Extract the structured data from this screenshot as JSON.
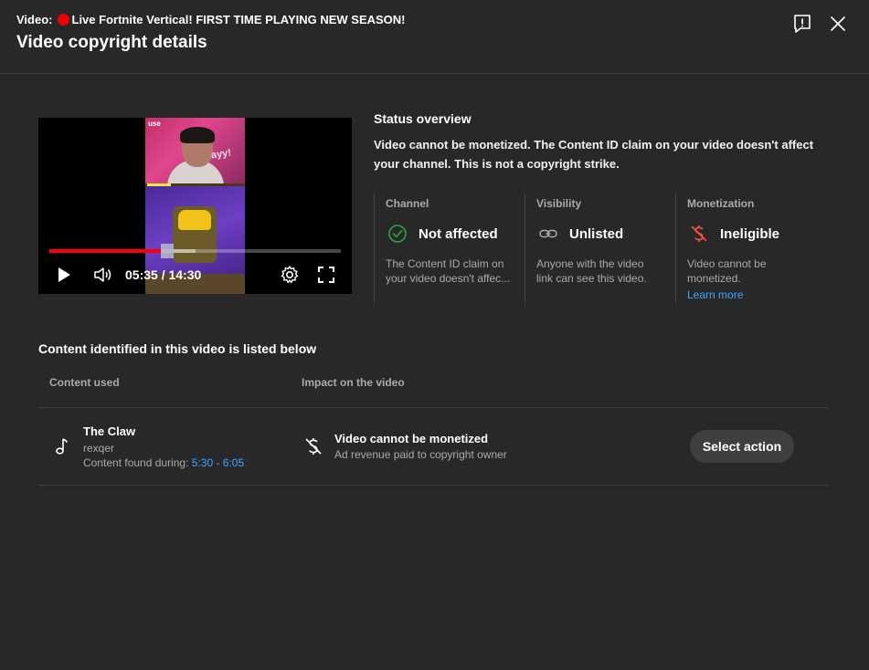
{
  "header": {
    "video_prefix": "Video:",
    "video_title": "Live Fortnite Vertical! FIRST TIME PLAYING NEW SEASON!",
    "dialog_title": "Video copyright details",
    "feedback_icon": "feedback-icon",
    "close_icon": "close-icon"
  },
  "player": {
    "current_time": "05:35",
    "duration": "14:30",
    "time_display": "05:35 / 14:30",
    "progress_fraction": 0.385,
    "buffered_fraction": 0.5,
    "thumbnail_text": "use",
    "thumbnail_word": "ayy!",
    "colors": {
      "progress": "#ff0000"
    }
  },
  "status": {
    "title": "Status overview",
    "description": "Video cannot be monetized. The Content ID claim on your video doesn't affect your channel. This is not a copyright strike.",
    "cards": [
      {
        "label": "Channel",
        "value": "Not affected",
        "icon": "check-circle-icon",
        "desc_line1": "The Content ID claim on",
        "desc_line2": "your video doesn't affec...",
        "color": "#2ba640"
      },
      {
        "label": "Visibility",
        "value": "Unlisted",
        "icon": "link-icon",
        "desc_line1": "Anyone with the video",
        "desc_line2": "link can see this video.",
        "color": "#aaaaaa"
      },
      {
        "label": "Monetization",
        "value": "Ineligible",
        "icon": "no-monetization-icon",
        "desc_line1": "Video cannot be",
        "desc_line2": "monetized.",
        "link": "Learn more",
        "color": "#ff4e45"
      }
    ]
  },
  "content": {
    "title": "Content identified in this video is listed below",
    "columns": [
      "Content used",
      "Impact on the video"
    ],
    "items": [
      {
        "icon": "music-note-icon",
        "title": "The Claw",
        "artist": "rexqer",
        "found_label": "Content found during:",
        "found_range": "5:30 - 6:05",
        "impact_icon": "no-monetization-icon",
        "impact_title": "Video cannot be monetized",
        "impact_desc": "Ad revenue paid to copyright owner",
        "action_label": "Select action"
      }
    ]
  }
}
